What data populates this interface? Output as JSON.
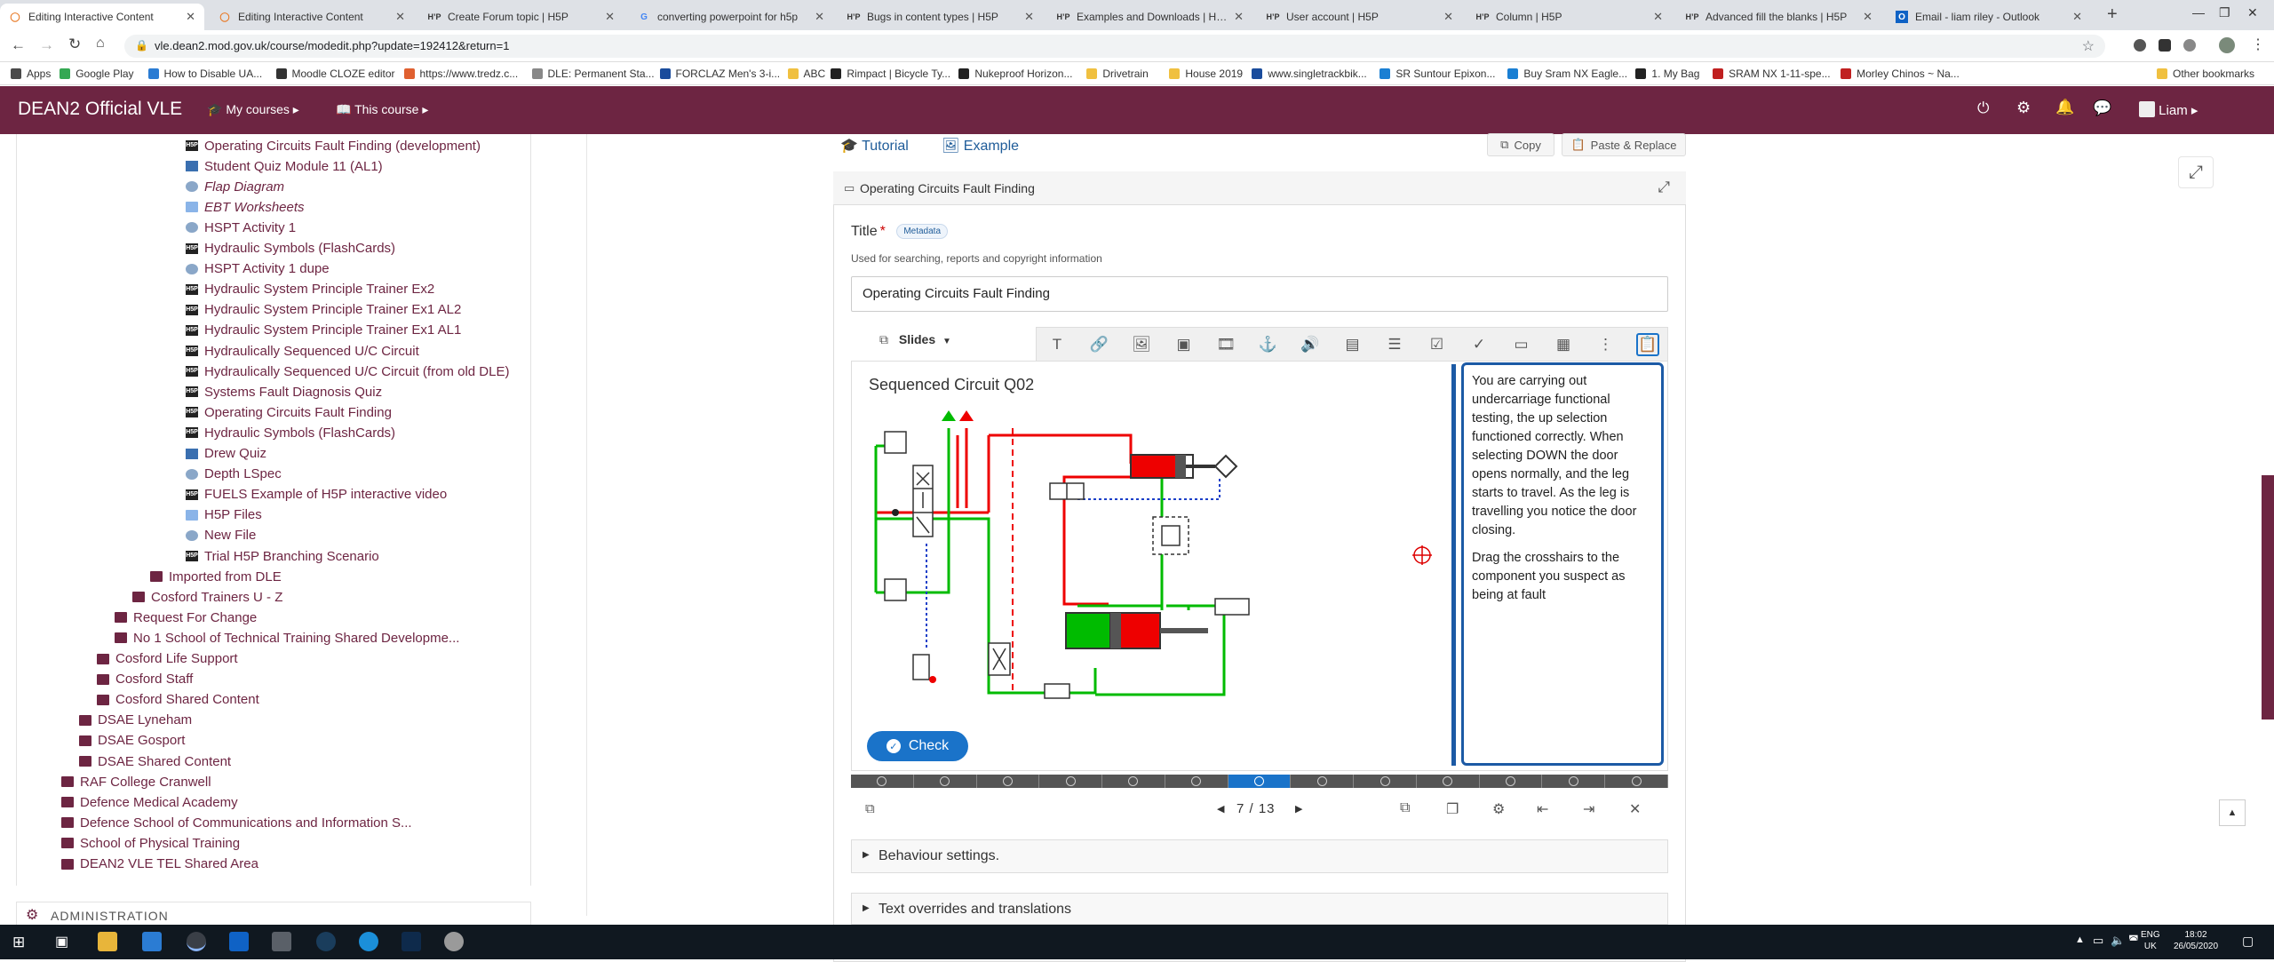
{
  "browser": {
    "tabs": [
      {
        "title": "Editing Interactive Content",
        "icon": "moodle-icon",
        "active": true
      },
      {
        "title": "Editing Interactive Content",
        "icon": "moodle-icon"
      },
      {
        "title": "Create Forum topic | H5P",
        "icon": "h5p-icon"
      },
      {
        "title": "converting powerpoint for h5p",
        "icon": "google-icon"
      },
      {
        "title": "Bugs in content types | H5P",
        "icon": "h5p-icon"
      },
      {
        "title": "Examples and Downloads | H5P",
        "icon": "h5p-icon"
      },
      {
        "title": "User account | H5P",
        "icon": "h5p-icon"
      },
      {
        "title": "Column | H5P",
        "icon": "h5p-icon"
      },
      {
        "title": "Advanced fill the blanks | H5P",
        "icon": "h5p-icon"
      },
      {
        "title": "Email - liam riley - Outlook",
        "icon": "outlook-icon"
      }
    ],
    "url": "vle.dean2.mod.gov.uk/course/modedit.php?update=192412&return=1",
    "bookmarks": [
      "Apps",
      "Google Play",
      "How to Disable UA...",
      "Moodle CLOZE editor",
      "https://www.tredz.c...",
      "DLE: Permanent Sta...",
      "FORCLAZ Men's 3-i...",
      "ABC",
      "Rimpact | Bicycle Ty...",
      "Nukeproof Horizon...",
      "Drivetrain",
      "House 2019",
      "www.singletrackbik...",
      "SR Suntour Epixon...",
      "Buy Sram NX Eagle...",
      "1. My Bag",
      "SRAM NX 1-11-spe...",
      "Morley Chinos ~ Na..."
    ],
    "other_bookmarks": "Other bookmarks"
  },
  "navbar": {
    "brand": "DEAN2 Official VLE",
    "my_courses": "My courses",
    "this_course": "This course",
    "user": "Liam"
  },
  "sidebar": {
    "items": [
      {
        "label": "Operating Circuits Fault Finding (development)",
        "indent": 3,
        "icon": "h5p"
      },
      {
        "label": "Student Quiz Module 11 (AL1)",
        "indent": 3,
        "icon": "quiz"
      },
      {
        "label": "Flap Diagram",
        "indent": 3,
        "icon": "url",
        "italic": true
      },
      {
        "label": "EBT Worksheets",
        "indent": 3,
        "icon": "folderb",
        "italic": true
      },
      {
        "label": "HSPT Activity 1",
        "indent": 3,
        "icon": "url"
      },
      {
        "label": "Hydraulic Symbols (FlashCards)",
        "indent": 3,
        "icon": "h5p"
      },
      {
        "label": "HSPT Activity 1 dupe",
        "indent": 3,
        "icon": "url"
      },
      {
        "label": "Hydraulic System Principle Trainer Ex2",
        "indent": 3,
        "icon": "h5p"
      },
      {
        "label": "Hydraulic System Principle Trainer Ex1 AL2",
        "indent": 3,
        "icon": "h5p"
      },
      {
        "label": "Hydraulic System Principle Trainer Ex1 AL1",
        "indent": 3,
        "icon": "h5p"
      },
      {
        "label": "Hydraulically Sequenced U/C Circuit",
        "indent": 3,
        "icon": "h5p"
      },
      {
        "label": "Hydraulically Sequenced U/C Circuit (from old DLE)",
        "indent": 3,
        "icon": "h5p"
      },
      {
        "label": "Systems Fault Diagnosis Quiz",
        "indent": 3,
        "icon": "h5p"
      },
      {
        "label": "Operating Circuits Fault Finding",
        "indent": 3,
        "icon": "h5p"
      },
      {
        "label": "Hydraulic Symbols (FlashCards)",
        "indent": 3,
        "icon": "h5p"
      },
      {
        "label": "Drew Quiz",
        "indent": 3,
        "icon": "quiz"
      },
      {
        "label": "Depth LSpec",
        "indent": 3,
        "icon": "url"
      },
      {
        "label": "FUELS Example of H5P interactive video",
        "indent": 3,
        "icon": "h5p"
      },
      {
        "label": "H5P Files",
        "indent": 3,
        "icon": "folderb"
      },
      {
        "label": "New File",
        "indent": 3,
        "icon": "url"
      },
      {
        "label": "Trial H5P Branching Scenario",
        "indent": 3,
        "icon": "h5p"
      },
      {
        "label": "Imported from DLE",
        "indent": 2,
        "icon": "folder"
      },
      {
        "label": "Cosford Trainers U - Z",
        "indent": 1.5,
        "icon": "folder"
      },
      {
        "label": "Request For Change",
        "indent": 1,
        "icon": "folder"
      },
      {
        "label": "No 1 School of Technical Training Shared Developme...",
        "indent": 1,
        "icon": "folder"
      },
      {
        "label": "Cosford Life Support",
        "indent": 0.5,
        "icon": "folder"
      },
      {
        "label": "Cosford Staff",
        "indent": 0.5,
        "icon": "folder"
      },
      {
        "label": "Cosford Shared Content",
        "indent": 0.5,
        "icon": "folder"
      },
      {
        "label": "DSAE Lyneham",
        "indent": 0,
        "icon": "folder"
      },
      {
        "label": "DSAE Gosport",
        "indent": 0,
        "icon": "folder"
      },
      {
        "label": "DSAE Shared Content",
        "indent": 0,
        "icon": "folder"
      },
      {
        "label": "RAF College Cranwell",
        "indent": -0.5,
        "icon": "folder"
      },
      {
        "label": "Defence Medical Academy",
        "indent": -0.5,
        "icon": "folder"
      },
      {
        "label": "Defence School of Communications and Information S...",
        "indent": -0.5,
        "icon": "folder"
      },
      {
        "label": "School of Physical Training",
        "indent": -0.5,
        "icon": "folder"
      },
      {
        "label": "DEAN2 VLE TEL Shared Area",
        "indent": -0.5,
        "icon": "folder"
      }
    ],
    "admin_label": "ADMINISTRATION"
  },
  "editor": {
    "tutorial": "Tutorial",
    "example": "Example",
    "copy": "Copy",
    "paste_replace": "Paste & Replace",
    "content_type": "Operating Circuits Fault Finding",
    "title_label": "Title",
    "metadata": "Metadata",
    "title_hint": "Used for searching, reports and copyright information",
    "title_value": "Operating Circuits Fault Finding",
    "slides_label": "Slides",
    "slide_title": "Sequenced Circuit Q02",
    "instruction_p1": "You are carrying out undercarriage functional testing, the up selection functioned correctly. When selecting DOWN the door opens normally, and the leg starts to travel. As the leg is travelling you notice the door closing.",
    "instruction_p2": "Drag the crosshairs to the component you suspect as being at fault",
    "check": "Check",
    "slide_total": 13,
    "slide_current": 7,
    "slide_counter": "7 / 13",
    "behaviour": "Behaviour settings.",
    "overrides": "Text overrides and translations"
  },
  "taskbar": {
    "lang1": "ENG",
    "lang2": "UK",
    "time": "18:02",
    "date": "26/05/2020"
  }
}
